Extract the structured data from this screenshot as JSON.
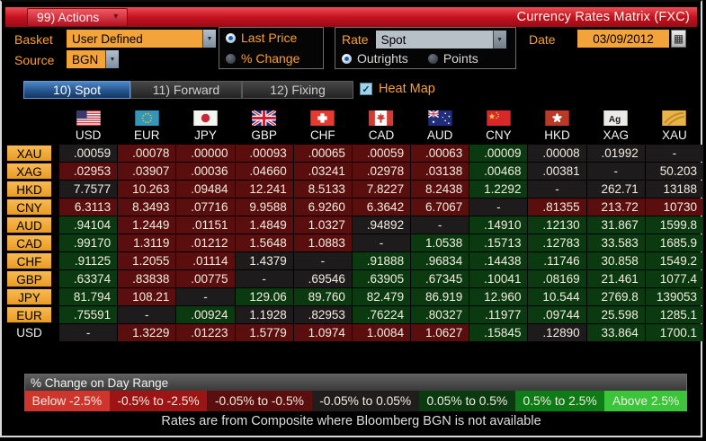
{
  "titlebar": {
    "actions_label": "99) Actions",
    "title": "Currency Rates Matrix (FXC)"
  },
  "controls": {
    "basket_label": "Basket",
    "basket_value": "User Defined",
    "source_label": "Source",
    "source_value": "BGN",
    "price_mode": {
      "options": [
        "Last Price",
        "% Change"
      ],
      "selected": "Last Price"
    },
    "rate_label": "Rate",
    "rate_value": "Spot",
    "rate_mode": {
      "options": [
        "Outrights",
        "Points"
      ],
      "selected": "Outrights"
    },
    "date_label": "Date",
    "date_value": "03/09/2012"
  },
  "tabs": [
    {
      "label": "10) Spot",
      "active": true
    },
    {
      "label": "11) Forward",
      "active": false
    },
    {
      "label": "12) Fixing",
      "active": false
    }
  ],
  "heatmap": {
    "label": "Heat Map",
    "checked": true
  },
  "matrix": {
    "columns": [
      {
        "code": "USD",
        "flag": "us-flag-icon"
      },
      {
        "code": "EUR",
        "flag": "eu-flag-icon"
      },
      {
        "code": "JPY",
        "flag": "japan-flag-icon"
      },
      {
        "code": "GBP",
        "flag": "uk-flag-icon"
      },
      {
        "code": "CHF",
        "flag": "switzerland-flag-icon"
      },
      {
        "code": "CAD",
        "flag": "canada-flag-icon"
      },
      {
        "code": "AUD",
        "flag": "australia-flag-icon"
      },
      {
        "code": "CNY",
        "flag": "china-flag-icon"
      },
      {
        "code": "HKD",
        "flag": "hongkong-flag-icon"
      },
      {
        "code": "XAG",
        "flag": "silver-icon"
      },
      {
        "code": "XAU",
        "flag": "gold-icon"
      }
    ],
    "rows": [
      {
        "label": "XAU",
        "style": "button",
        "cells": [
          [
            ".00059",
            "k"
          ],
          [
            ".00078",
            "r"
          ],
          [
            ".00000",
            "r"
          ],
          [
            ".00093",
            "r"
          ],
          [
            ".00065",
            "r"
          ],
          [
            ".00059",
            "r"
          ],
          [
            ".00063",
            "r"
          ],
          [
            ".00009",
            "g"
          ],
          [
            ".00008",
            "k"
          ],
          [
            ".01992",
            "k"
          ],
          [
            "-",
            "k"
          ]
        ]
      },
      {
        "label": "XAG",
        "style": "button",
        "cells": [
          [
            ".02953",
            "r"
          ],
          [
            ".03907",
            "r"
          ],
          [
            ".00036",
            "r"
          ],
          [
            ".04660",
            "r"
          ],
          [
            ".03241",
            "r"
          ],
          [
            ".02978",
            "r"
          ],
          [
            ".03138",
            "r"
          ],
          [
            ".00468",
            "g"
          ],
          [
            ".00381",
            "k"
          ],
          [
            "-",
            "k"
          ],
          [
            "50.203",
            "k"
          ]
        ]
      },
      {
        "label": "HKD",
        "style": "button",
        "cells": [
          [
            "7.7577",
            "k"
          ],
          [
            "10.263",
            "r"
          ],
          [
            ".09484",
            "r"
          ],
          [
            "12.241",
            "r"
          ],
          [
            "8.5133",
            "r"
          ],
          [
            "7.8227",
            "r"
          ],
          [
            "8.2438",
            "r"
          ],
          [
            "1.2292",
            "g"
          ],
          [
            "-",
            "k"
          ],
          [
            "262.71",
            "k"
          ],
          [
            "13188",
            "k"
          ]
        ]
      },
      {
        "label": "CNY",
        "style": "button",
        "cells": [
          [
            "6.3113",
            "r"
          ],
          [
            "8.3493",
            "r"
          ],
          [
            ".07716",
            "r"
          ],
          [
            "9.9588",
            "r"
          ],
          [
            "6.9260",
            "r"
          ],
          [
            "6.3642",
            "r"
          ],
          [
            "6.7067",
            "r"
          ],
          [
            "-",
            "k"
          ],
          [
            ".81355",
            "r"
          ],
          [
            "213.72",
            "r"
          ],
          [
            "10730",
            "r"
          ]
        ]
      },
      {
        "label": "AUD",
        "style": "button",
        "cells": [
          [
            ".94104",
            "g"
          ],
          [
            "1.2449",
            "r"
          ],
          [
            ".01151",
            "r"
          ],
          [
            "1.4849",
            "r"
          ],
          [
            "1.0327",
            "r"
          ],
          [
            ".94892",
            "k"
          ],
          [
            "-",
            "k"
          ],
          [
            ".14910",
            "g"
          ],
          [
            ".12130",
            "g"
          ],
          [
            "31.867",
            "g"
          ],
          [
            "1599.8",
            "g"
          ]
        ]
      },
      {
        "label": "CAD",
        "style": "button",
        "cells": [
          [
            ".99170",
            "g"
          ],
          [
            "1.3119",
            "r"
          ],
          [
            ".01212",
            "r"
          ],
          [
            "1.5648",
            "r"
          ],
          [
            "1.0883",
            "r"
          ],
          [
            "-",
            "k"
          ],
          [
            "1.0538",
            "g"
          ],
          [
            ".15713",
            "g"
          ],
          [
            ".12783",
            "g"
          ],
          [
            "33.583",
            "g"
          ],
          [
            "1685.9",
            "g"
          ]
        ]
      },
      {
        "label": "CHF",
        "style": "button",
        "cells": [
          [
            ".91125",
            "g"
          ],
          [
            "1.2055",
            "r"
          ],
          [
            ".01114",
            "r"
          ],
          [
            "1.4379",
            "k"
          ],
          [
            "-",
            "k"
          ],
          [
            ".91888",
            "g"
          ],
          [
            ".96834",
            "g"
          ],
          [
            ".14438",
            "g"
          ],
          [
            ".11746",
            "g"
          ],
          [
            "30.858",
            "g"
          ],
          [
            "1549.2",
            "g"
          ]
        ]
      },
      {
        "label": "GBP",
        "style": "button",
        "cells": [
          [
            ".63374",
            "g"
          ],
          [
            ".83838",
            "r"
          ],
          [
            ".00775",
            "r"
          ],
          [
            "-",
            "k"
          ],
          [
            ".69546",
            "k"
          ],
          [
            ".63905",
            "g"
          ],
          [
            ".67345",
            "g"
          ],
          [
            ".10041",
            "g"
          ],
          [
            ".08169",
            "g"
          ],
          [
            "21.461",
            "g"
          ],
          [
            "1077.4",
            "g"
          ]
        ]
      },
      {
        "label": "JPY",
        "style": "button",
        "cells": [
          [
            "81.794",
            "g"
          ],
          [
            "108.21",
            "r"
          ],
          [
            "-",
            "k"
          ],
          [
            "129.06",
            "g"
          ],
          [
            "89.760",
            "g"
          ],
          [
            "82.479",
            "g"
          ],
          [
            "86.919",
            "g"
          ],
          [
            "12.960",
            "g"
          ],
          [
            "10.544",
            "g"
          ],
          [
            "2769.8",
            "g"
          ],
          [
            "139053",
            "g"
          ]
        ]
      },
      {
        "label": "EUR",
        "style": "button",
        "cells": [
          [
            ".75591",
            "g"
          ],
          [
            "-",
            "k"
          ],
          [
            ".00924",
            "g"
          ],
          [
            "1.1928",
            "k"
          ],
          [
            ".82953",
            "k"
          ],
          [
            ".76224",
            "g"
          ],
          [
            ".80327",
            "g"
          ],
          [
            ".11977",
            "g"
          ],
          [
            ".09744",
            "g"
          ],
          [
            "25.598",
            "g"
          ],
          [
            "1285.1",
            "g"
          ]
        ]
      },
      {
        "label": "USD",
        "style": "plain",
        "cells": [
          [
            "-",
            "k"
          ],
          [
            "1.3229",
            "r"
          ],
          [
            ".01223",
            "r"
          ],
          [
            "1.5779",
            "r"
          ],
          [
            "1.0974",
            "r"
          ],
          [
            "1.0084",
            "r"
          ],
          [
            "1.0627",
            "r"
          ],
          [
            ".15845",
            "g"
          ],
          [
            ".12890",
            "k"
          ],
          [
            "33.864",
            "g"
          ],
          [
            "1700.1",
            "g"
          ]
        ]
      }
    ]
  },
  "legend": {
    "title": "% Change on Day Range",
    "segments": [
      {
        "label": "Below -2.5%",
        "color": "#ce352c"
      },
      {
        "label": "-0.5% to -2.5%",
        "color": "#9c1414"
      },
      {
        "label": "-0.05% to -0.5%",
        "color": "#5a0e0e"
      },
      {
        "label": "-0.05% to 0.05%",
        "color": "#211d1d"
      },
      {
        "label": "0.05% to 0.5%",
        "color": "#0c3a10"
      },
      {
        "label": "0.5% to 2.5%",
        "color": "#0e7c16"
      },
      {
        "label": "Above 2.5%",
        "color": "#3bc53b"
      }
    ]
  },
  "footer": "Rates are from Composite where Bloomberg BGN is not available",
  "colors": {
    "accent_orange": "#f2a43a",
    "label_orange": "#ff9e2a",
    "titlebar_red": "#c41320",
    "active_tab_blue": "#27558e",
    "cell_red": "#5a0e0e",
    "cell_neutral": "#1d1b1b",
    "cell_green": "#0c3a10",
    "heatmap_check_blue": "#9fd3ea"
  }
}
